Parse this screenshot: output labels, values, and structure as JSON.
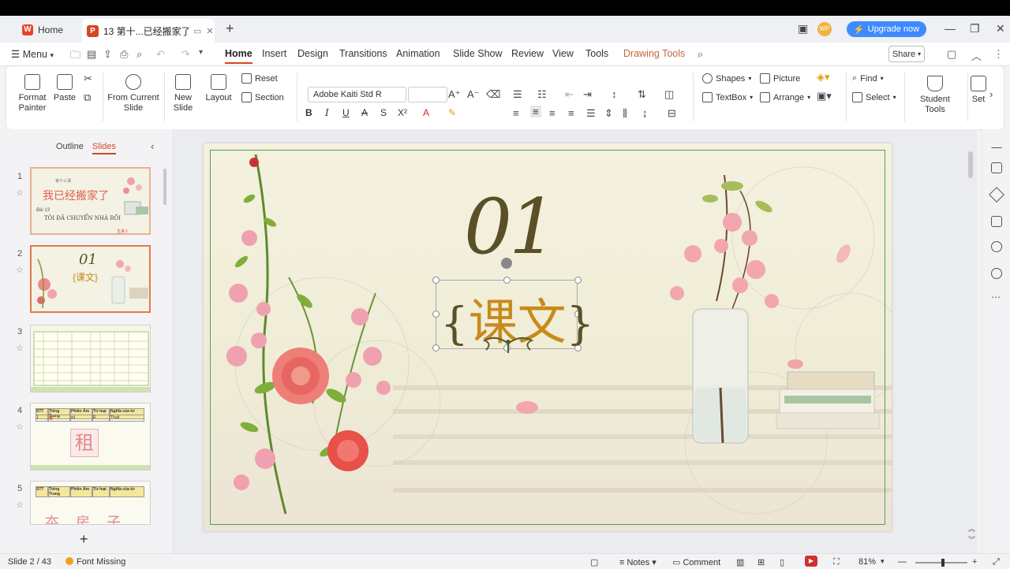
{
  "titlebar": {
    "home_tab": "Home",
    "doc_tab": "13 第十...已经搬家了",
    "upgrade": "Upgrade now",
    "avatar": "WP"
  },
  "menu": {
    "menu_label": "Menu",
    "tabs": [
      "Home",
      "Insert",
      "Design",
      "Transitions",
      "Animation",
      "Slide Show",
      "Review",
      "View",
      "Tools",
      "Drawing Tools"
    ],
    "share": "Share"
  },
  "ribbon": {
    "format_painter": "Format Painter",
    "paste": "Paste",
    "from_current_slide": "From Current Slide",
    "new_slide": "New Slide",
    "layout": "Layout",
    "reset": "Reset",
    "section": "Section",
    "font_name": "Adobe Kaiti Std R",
    "font_size": "",
    "shapes": "Shapes",
    "picture": "Picture",
    "textbox": "TextBox",
    "arrange": "Arrange",
    "find": "Find",
    "select": "Select",
    "student_tools": "Student Tools",
    "settings_partial": "Set"
  },
  "left_panel": {
    "outline_tab": "Outline",
    "slides_tab": "Slides",
    "thumbs": [
      {
        "num": "1",
        "title": "我已经搬家了",
        "sub": "TÔI ĐÃ CHUYỂN NHÀ RỒI",
        "lesson": "Bài 13",
        "chapter": "第十三课",
        "author": "主讲人"
      },
      {
        "num": "2",
        "title": "01",
        "sub": "{课文}"
      },
      {
        "num": "3"
      },
      {
        "num": "4",
        "glyph": "租"
      },
      {
        "num": "5",
        "glyph": "夲 房 子"
      }
    ],
    "table_headers": [
      "STT",
      "Tiếng Trung",
      "Phiên Âm",
      "Từ loại",
      "Nghĩa của từ"
    ],
    "table_row_4": [
      "1",
      "租",
      "zū",
      "Đ",
      "Thuê"
    ]
  },
  "slide": {
    "number": "01",
    "title_open": "{",
    "title_text": "课文",
    "title_close": "}"
  },
  "status": {
    "slide_pos": "Slide 2 / 43",
    "font_missing": "Font Missing",
    "notes": "Notes",
    "comment": "Comment",
    "zoom": "81%"
  },
  "colors": {
    "accent": "#d24726",
    "upgrade": "#3e8bff",
    "slide_title": "#c88a1a",
    "slide_number": "#5a5028",
    "frame": "#5a9c5a"
  }
}
